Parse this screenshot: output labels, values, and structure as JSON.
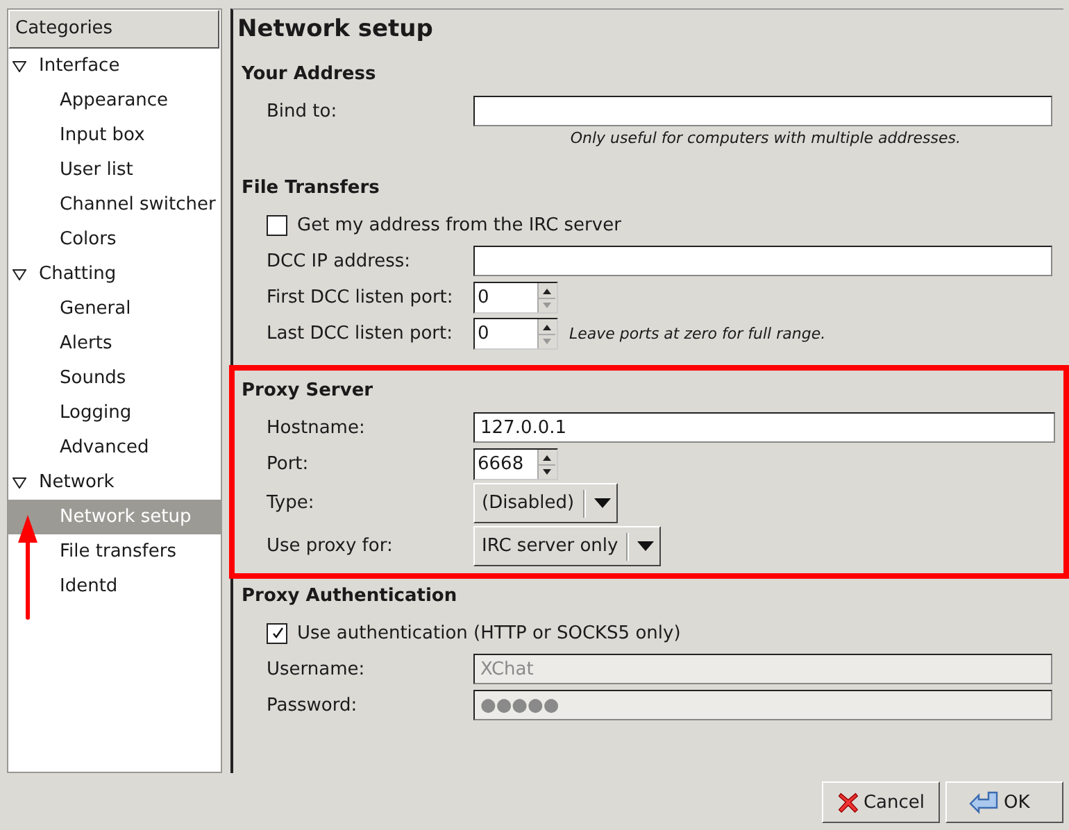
{
  "sidebar": {
    "header": "Categories",
    "items": [
      {
        "label": "Interface",
        "expanded": true,
        "children": [
          {
            "label": "Appearance",
            "selected": false,
            "pointer_arrow": false
          },
          {
            "label": "Input box",
            "selected": false,
            "pointer_arrow": false
          },
          {
            "label": "User list",
            "selected": false,
            "pointer_arrow": false
          },
          {
            "label": "Channel switcher",
            "selected": false,
            "pointer_arrow": false
          },
          {
            "label": "Colors",
            "selected": false,
            "pointer_arrow": false
          }
        ]
      },
      {
        "label": "Chatting",
        "expanded": true,
        "children": [
          {
            "label": "General",
            "selected": false,
            "pointer_arrow": false
          },
          {
            "label": "Alerts",
            "selected": false,
            "pointer_arrow": false
          },
          {
            "label": "Sounds",
            "selected": false,
            "pointer_arrow": false
          },
          {
            "label": "Logging",
            "selected": false,
            "pointer_arrow": false
          },
          {
            "label": "Advanced",
            "selected": false,
            "pointer_arrow": false
          }
        ]
      },
      {
        "label": "Network",
        "expanded": true,
        "children": [
          {
            "label": "Network setup",
            "selected": true,
            "pointer_arrow": true
          },
          {
            "label": "File transfers",
            "selected": false,
            "pointer_arrow": false
          },
          {
            "label": "Identd",
            "selected": false,
            "pointer_arrow": false
          }
        ]
      }
    ]
  },
  "page": {
    "title": "Network setup",
    "sections": [
      {
        "title": "Your Address",
        "highlighted": false,
        "rows": [
          {
            "kind": "field",
            "label": "Bind to:",
            "disabled": false
          },
          {
            "kind": "note",
            "text": "Only useful for computers with multiple addresses."
          }
        ]
      },
      {
        "title": "File Transfers",
        "highlighted": false,
        "rows": [
          {
            "kind": "checkbox",
            "label": "Get my address from the IRC server",
            "checked": false
          },
          {
            "kind": "field",
            "label": "DCC IP address:",
            "disabled": false
          },
          {
            "kind": "spin",
            "label": "First DCC listen port:",
            "value": "0"
          },
          {
            "kind": "spin",
            "label": "Last DCC listen port:",
            "value": "0",
            "note": "Leave ports at zero for full range."
          }
        ]
      },
      {
        "title": "Proxy Server",
        "highlighted": true,
        "rows": [
          {
            "kind": "field",
            "label": "Hostname:",
            "value": "127.0.0.1",
            "disabled": false
          },
          {
            "kind": "spin",
            "label": "Port:",
            "value": "6668"
          },
          {
            "kind": "combo",
            "label": "Type:",
            "value": "(Disabled)"
          },
          {
            "kind": "combo",
            "label": "Use proxy for:",
            "value": "IRC server only"
          }
        ]
      },
      {
        "title": "Proxy Authentication",
        "highlighted": false,
        "rows": [
          {
            "kind": "checkbox",
            "label": "Use authentication (HTTP or SOCKS5 only)",
            "checked": true
          },
          {
            "kind": "field",
            "label": "Username:",
            "value": "XChat",
            "disabled": true
          },
          {
            "kind": "field",
            "label": "Password:",
            "value": "●●●●●",
            "disabled": true
          }
        ]
      }
    ]
  },
  "buttons": [
    {
      "label": "Cancel",
      "kind": "cancel"
    },
    {
      "label": "OK",
      "kind": "ok"
    }
  ]
}
